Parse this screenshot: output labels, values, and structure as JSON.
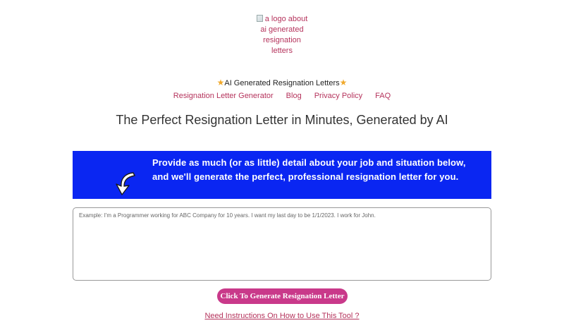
{
  "logo": {
    "alt_text": "a logo about ai generated resignation letters",
    "icon": "broken-image-icon"
  },
  "site_name": {
    "label": "AI Generated Resignation Letters",
    "icon": "star-icon",
    "icon_color": "#f0a92c"
  },
  "nav": {
    "items": [
      {
        "label": "Resignation Letter Generator"
      },
      {
        "label": "Blog"
      },
      {
        "label": "Privacy Policy"
      },
      {
        "label": "FAQ"
      }
    ],
    "link_color": "#b5335c"
  },
  "headline": "The Perfect Resignation Letter in Minutes, Generated by AI",
  "banner": {
    "text": "Provide as much (or as little) detail about your job and situation below, and we'll generate the perfect, professional resignation letter for you.",
    "background_color": "#0a26f2",
    "icon": "curved-arrow-down-icon"
  },
  "details_input": {
    "value": "",
    "placeholder": "Example: I'm a Programmer working for ABC Company for 10 years. I want my last day to be 1/1/2023. I work for John."
  },
  "generate_button": {
    "label": "Click To Generate Resignation Letter",
    "background_color": "#c9398a"
  },
  "instructions_link": {
    "label": "Need Instructions On How to Use This Tool ?"
  }
}
